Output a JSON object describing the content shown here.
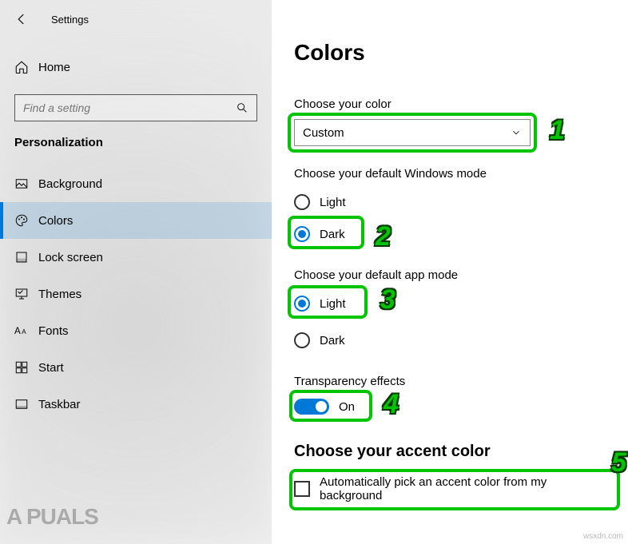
{
  "header": {
    "title": "Settings"
  },
  "home": {
    "label": "Home"
  },
  "search": {
    "placeholder": "Find a setting"
  },
  "section": "Personalization",
  "sidebar": {
    "items": [
      {
        "label": "Background"
      },
      {
        "label": "Colors"
      },
      {
        "label": "Lock screen"
      },
      {
        "label": "Themes"
      },
      {
        "label": "Fonts"
      },
      {
        "label": "Start"
      },
      {
        "label": "Taskbar"
      }
    ]
  },
  "main": {
    "heading": "Colors",
    "choose_color_label": "Choose your color",
    "choose_color_value": "Custom",
    "windows_mode_label": "Choose your default Windows mode",
    "windows_mode": {
      "light": "Light",
      "dark": "Dark"
    },
    "app_mode_label": "Choose your default app mode",
    "app_mode": {
      "light": "Light",
      "dark": "Dark"
    },
    "transparency_label": "Transparency effects",
    "transparency_state": "On",
    "accent_heading": "Choose your accent color",
    "accent_auto": "Automatically pick an accent color from my background"
  },
  "annotations": {
    "n1": "1",
    "n2": "2",
    "n3": "3",
    "n4": "4",
    "n5": "5"
  },
  "branding": {
    "logo": "A  PUALS",
    "watermark": "wsxdn.com"
  }
}
